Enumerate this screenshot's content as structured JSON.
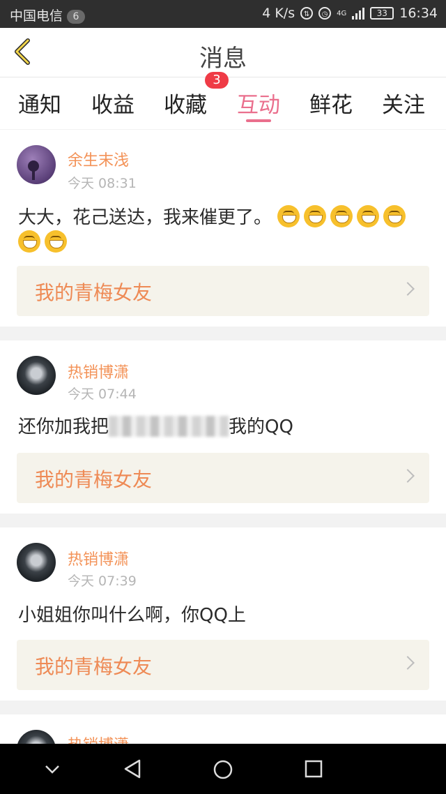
{
  "status_bar": {
    "carrier": "中国电信",
    "notification_count": "6",
    "net_speed": "4 K/s",
    "network": "4G",
    "battery": "33",
    "time": "16:34"
  },
  "header": {
    "title": "消息"
  },
  "tabs": [
    {
      "label": "通知"
    },
    {
      "label": "收益"
    },
    {
      "label": "收藏",
      "badge": "3"
    },
    {
      "label": "互动",
      "active": true
    },
    {
      "label": "鲜花"
    },
    {
      "label": "关注"
    }
  ],
  "messages": [
    {
      "user": "余生末浅",
      "time": "今天 08:31",
      "text": "大大，花己送达，我来催更了。",
      "emoji_count": 7,
      "book": "我的青梅女友"
    },
    {
      "user": "热销博潇",
      "time": "今天 07:44",
      "text_before": "还你加我把",
      "text_after": "我的QQ",
      "book": "我的青梅女友"
    },
    {
      "user": "热销博潇",
      "time": "今天 07:39",
      "text": "小姐姐你叫什么啊，你QQ上",
      "book": "我的青梅女友"
    },
    {
      "user": "热销博潇"
    }
  ],
  "colors": {
    "accent": "#ea6f8d",
    "username": "#f39257",
    "book_bg": "#f5f3eb"
  }
}
